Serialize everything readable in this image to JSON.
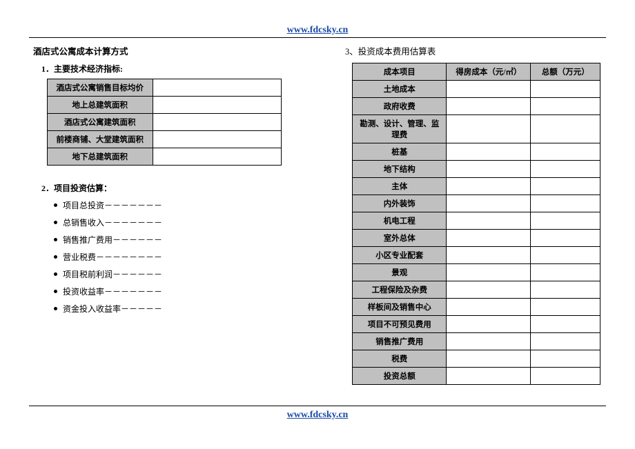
{
  "header_url": "www.fdcsky.cn",
  "footer_url": "www.fdcsky.cn",
  "doc_title": "酒店式公寓成本计算方式",
  "section1": {
    "title": "1．主要技术经济指标:",
    "rows": [
      "酒店式公寓销售目标均价",
      "地上总建筑面积",
      "酒店式公寓建筑面积",
      "前楼商铺、大堂建筑面积",
      "地下总建筑面积"
    ]
  },
  "section2": {
    "title": "2．项目投资估算：",
    "items": [
      "项目总投资－－－－－－－",
      "总销售收入－－－－－－－",
      "销售推广费用－－－－－－",
      "营业税费－－－－－－－－",
      "项目税前利润－－－－－－",
      "投资收益率－－－－－－－",
      "资金投入收益率－－－－－"
    ]
  },
  "section3": {
    "title": "3、投资成本费用估算表",
    "headers": [
      "成本项目",
      "得房成本（元/㎡）",
      "总额（万元）"
    ],
    "rows": [
      "土地成本",
      "政府收费",
      "勘测、设计、管理、监理费",
      "桩基",
      "地下结构",
      "主体",
      "内外装饰",
      "机电工程",
      "室外总体",
      "小区专业配套",
      "景观",
      "工程保险及杂费",
      "样板间及销售中心",
      "项目不可预见费用",
      "销售推广费用",
      "税费",
      "投资总额"
    ]
  }
}
